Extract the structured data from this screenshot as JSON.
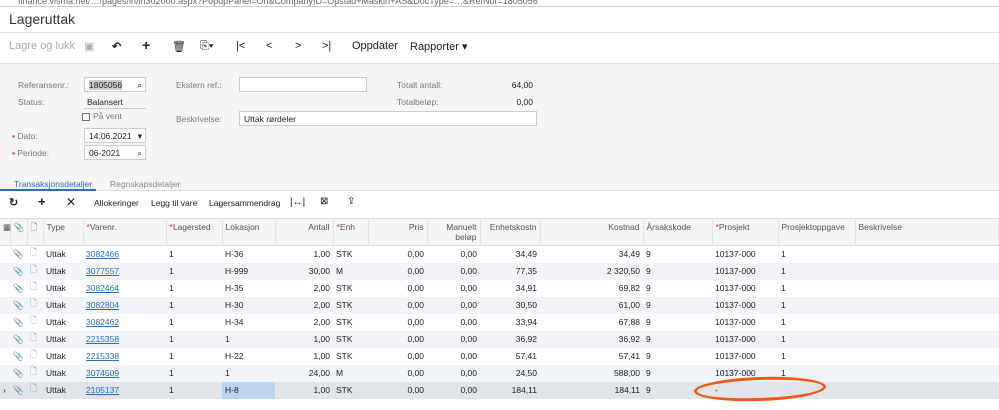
{
  "url": "finance.visma.net/…/pages/in/in302000.aspx?PopupPanel=On&CompanyID=Opstad+Maskin+AS&DocType=…&RefNbr=1805056",
  "title": "Lageruttak",
  "toolbar": {
    "save_close": "Lagre og lukk",
    "update": "Oppdater",
    "reports": "Rapporter ▾"
  },
  "form": {
    "ref_label": "Referansenr.:",
    "ref_value": "1805056",
    "status_label": "Status:",
    "status_value": "Balansert",
    "hold_label": "På vent",
    "date_label": "Dato:",
    "date_value": "14.06.2021",
    "period_label": "Periode:",
    "period_value": "06-2021",
    "extref_label": "Ekstern ref.:",
    "extref_value": "",
    "desc_label": "Beskrivelse:",
    "desc_value": "Uttak rørdeler",
    "total_qty_label": "Totalt antall:",
    "total_qty_value": "64,00",
    "total_amt_label": "Totalbeløp:",
    "total_amt_value": "0,00"
  },
  "tabs": [
    "Transaksjonsdetaljer",
    "Regnskapsdetaljer"
  ],
  "grid_toolbar": {
    "allocations": "Allokeringer",
    "add_item": "Legg til vare",
    "summary": "Lagersammendrag"
  },
  "columns": [
    "Type",
    "Varenr.",
    "Lagersted",
    "Lokasjon",
    "Antall",
    "Enh",
    "Pris",
    "Manuelt beløp",
    "Enhetskostn",
    "Kostnad",
    "Årsakskode",
    "Prosjekt",
    "Prosjektoppgave",
    "Beskrivelse"
  ],
  "rows": [
    [
      "Uttak",
      "3082466",
      "1",
      "H-36",
      "1,00",
      "STK",
      "0,00",
      "0,00",
      "34,49",
      "34,49",
      "9",
      "10137-000",
      "1",
      ""
    ],
    [
      "Uttak",
      "3077557",
      "1",
      "H-999",
      "30,00",
      "M",
      "0,00",
      "0,00",
      "77,35",
      "2 320,50",
      "9",
      "10137-000",
      "1",
      ""
    ],
    [
      "Uttak",
      "3082464",
      "1",
      "H-35",
      "2,00",
      "STK",
      "0,00",
      "0,00",
      "34,91",
      "69,82",
      "9",
      "10137-000",
      "1",
      ""
    ],
    [
      "Uttak",
      "3082804",
      "1",
      "H-30",
      "2,00",
      "STK",
      "0,00",
      "0,00",
      "30,50",
      "61,00",
      "9",
      "10137-000",
      "1",
      ""
    ],
    [
      "Uttak",
      "3082462",
      "1",
      "H-34",
      "2,00",
      "STK",
      "0,00",
      "0,00",
      "33,94",
      "67,88",
      "9",
      "10137-000",
      "1",
      ""
    ],
    [
      "Uttak",
      "2215358",
      "1",
      "1",
      "1,00",
      "STK",
      "0,00",
      "0,00",
      "36,92",
      "36,92",
      "9",
      "10137-000",
      "1",
      ""
    ],
    [
      "Uttak",
      "2215338",
      "1",
      "H-22",
      "1,00",
      "STK",
      "0,00",
      "0,00",
      "57,41",
      "57,41",
      "9",
      "10137-000",
      "1",
      ""
    ],
    [
      "Uttak",
      "3074509",
      "1",
      "1",
      "24,00",
      "M",
      "0,00",
      "0,00",
      "24,50",
      "588,00",
      "9",
      "10137-000",
      "1",
      ""
    ],
    [
      "Uttak",
      "2105137",
      "1",
      "H-8",
      "1,00",
      "STK",
      "0,00",
      "0,00",
      "184,11",
      "184,11",
      "9",
      "-",
      "",
      ""
    ]
  ],
  "colors": {
    "accent": "#2a6fbf",
    "annotation": "#f05a16",
    "selected_cell": "#bcd6ef"
  }
}
